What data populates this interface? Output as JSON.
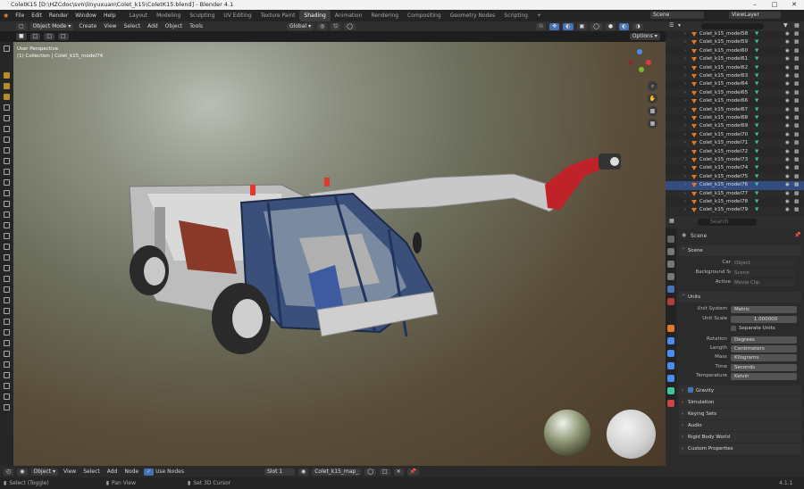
{
  "title_bar": {
    "text": "ColetK15 [D:\\HZCdoc\\svn\\linyuxuan\\Colet_k15\\ColetK15.blend] - Blender 4.1"
  },
  "menus": [
    "File",
    "Edit",
    "Render",
    "Window",
    "Help"
  ],
  "workspaces": [
    "Layout",
    "Modeling",
    "Sculpting",
    "UV Editing",
    "Texture Paint",
    "Shading",
    "Animation",
    "Rendering",
    "Compositing",
    "Geometry Nodes",
    "Scripting"
  ],
  "active_workspace": "Shading",
  "scene_field": "Scene",
  "viewlayer_field": "ViewLayer",
  "viewport_header": {
    "mode": "Object Mode",
    "menus": [
      "Create",
      "View",
      "Select",
      "Add",
      "Object",
      "Tools"
    ],
    "orientation": "Global",
    "options": "Options"
  },
  "viewport_overlay": {
    "perspective": "User Perspective",
    "collection": "(1) Collection | Colet_k15_model74"
  },
  "outliner": {
    "search_placeholder": "",
    "items": [
      "Colet_k15_model58",
      "Colet_k15_model59",
      "Colet_k15_model60",
      "Colet_k15_model61",
      "Colet_k15_model62",
      "Colet_k15_model63",
      "Colet_k15_model64",
      "Colet_k15_model65",
      "Colet_k15_model66",
      "Colet_k15_model67",
      "Colet_k15_model68",
      "Colet_k15_model69",
      "Colet_k15_model70",
      "Colet_k15_model71",
      "Colet_k15_model72",
      "Colet_k15_model73",
      "Colet_k15_model74",
      "Colet_k15_model75",
      "Colet_k15_model76",
      "Colet_k15_model77",
      "Colet_k15_model78",
      "Colet_k15_model79"
    ],
    "selected": "Colet_k15_model76"
  },
  "properties": {
    "search_placeholder": "Search",
    "breadcrumb": "Scene",
    "scene_section": "Scene",
    "camera_label": "Camera",
    "camera_placeholder": "Object",
    "bg_label": "Background Scene",
    "bg_placeholder": "Scene",
    "clip_label": "Active Clip",
    "clip_placeholder": "Movie Clip",
    "units_section": "Units",
    "unit_system_label": "Unit System",
    "unit_system": "Metric",
    "unit_scale_label": "Unit Scale",
    "unit_scale": "1.000000",
    "separate_units": "Separate Units",
    "rotation_label": "Rotation",
    "rotation": "Degrees",
    "length_label": "Length",
    "length": "Centimeters",
    "mass_label": "Mass",
    "mass": "Kilograms",
    "time_label": "Time",
    "time": "Seconds",
    "temperature_label": "Temperature",
    "temperature": "Kelvin",
    "collapsed_sections": [
      "Gravity",
      "Simulation",
      "Keying Sets",
      "Audio",
      "Rigid Body World",
      "Custom Properties"
    ]
  },
  "node_header": {
    "type": "Object",
    "menus": [
      "View",
      "Select",
      "Add",
      "Node"
    ],
    "use_nodes": "Use Nodes",
    "slot": "Slot 1",
    "material": "Colet_k15_map_"
  },
  "status_bar": {
    "left": "Select (Toggle)",
    "middle": "Pan View",
    "right": "Set 3D Cursor",
    "version": "4.1.1"
  }
}
